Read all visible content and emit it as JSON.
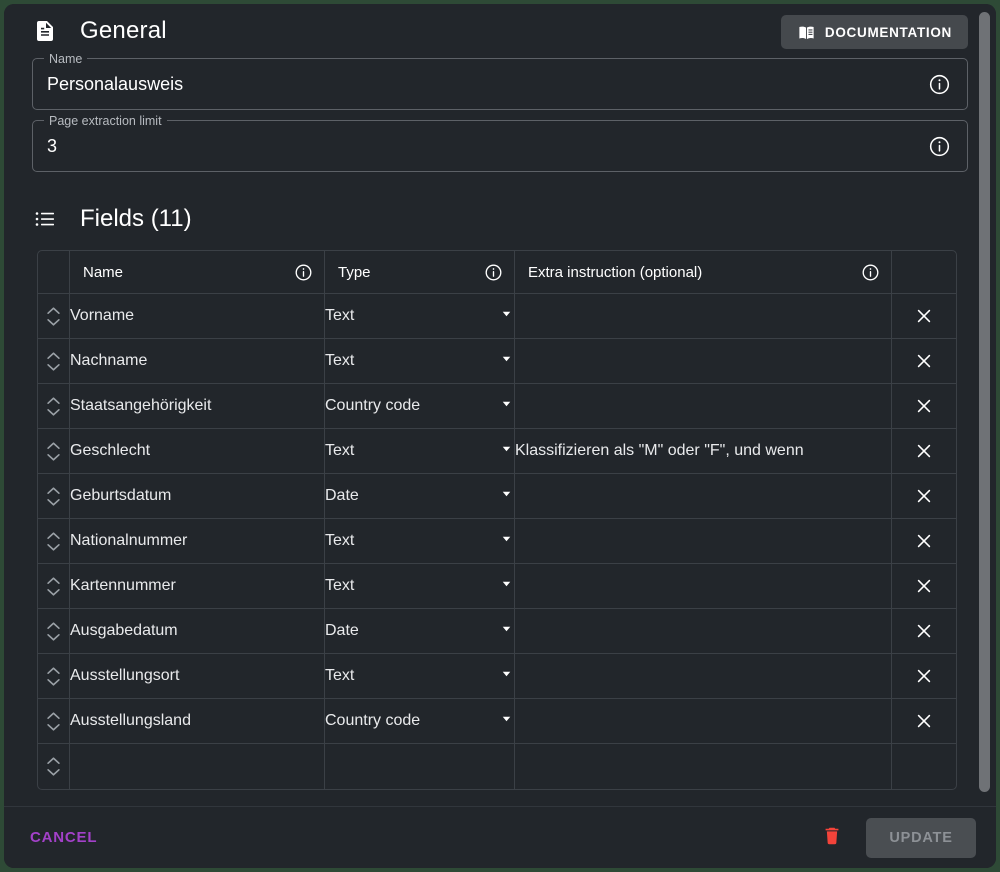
{
  "general": {
    "title": "General",
    "icon": "document-icon",
    "documentation_button": {
      "label": "DOCUMENTATION",
      "icon": "menu-book-icon"
    },
    "name_field": {
      "label": "Name",
      "value": "Personalausweis",
      "info_icon": "info-icon"
    },
    "page_limit_field": {
      "label": "Page extraction limit",
      "value": "3",
      "info_icon": "info-icon"
    }
  },
  "fields_section": {
    "title": "Fields (11)",
    "icon": "list-icon",
    "columns": [
      {
        "label": "Name",
        "info_icon": "info-icon"
      },
      {
        "label": "Type",
        "info_icon": "info-icon"
      },
      {
        "label": "Extra instruction (optional)",
        "info_icon": "info-icon"
      }
    ],
    "rows": [
      {
        "name": "Vorname",
        "type": "Text",
        "extra": ""
      },
      {
        "name": "Nachname",
        "type": "Text",
        "extra": ""
      },
      {
        "name": "Staatsangehörigkeit",
        "type": "Country code",
        "extra": ""
      },
      {
        "name": "Geschlecht",
        "type": "Text",
        "extra": "Klassifizieren als \"M\" oder \"F\", und wenn"
      },
      {
        "name": "Geburtsdatum",
        "type": "Date",
        "extra": ""
      },
      {
        "name": "Nationalnummer",
        "type": "Text",
        "extra": ""
      },
      {
        "name": "Kartennummer",
        "type": "Text",
        "extra": ""
      },
      {
        "name": "Ausgabedatum",
        "type": "Date",
        "extra": ""
      },
      {
        "name": "Ausstellungsort",
        "type": "Text",
        "extra": ""
      },
      {
        "name": "Ausstellungsland",
        "type": "Country code",
        "extra": ""
      },
      {
        "name": "",
        "type": "",
        "extra": ""
      }
    ],
    "delete_row_icon": "close-icon",
    "sort_up_icon": "chevron-up-icon",
    "sort_down_icon": "chevron-down-icon"
  },
  "footer": {
    "cancel_label": "CANCEL",
    "delete_icon": "trash-icon",
    "update_label": "UPDATE"
  },
  "colors": {
    "panel_background": "#22262b",
    "outer_border": "#2e4a36",
    "cancel_purple": "#a341c9",
    "delete_red": "#f4433a",
    "update_disabled_bg": "#4a4e52",
    "update_disabled_text": "#8d9196",
    "doc_button_bg": "#45494d",
    "table_border": "#3b4046",
    "scrollbar_thumb": "#6f7276"
  }
}
